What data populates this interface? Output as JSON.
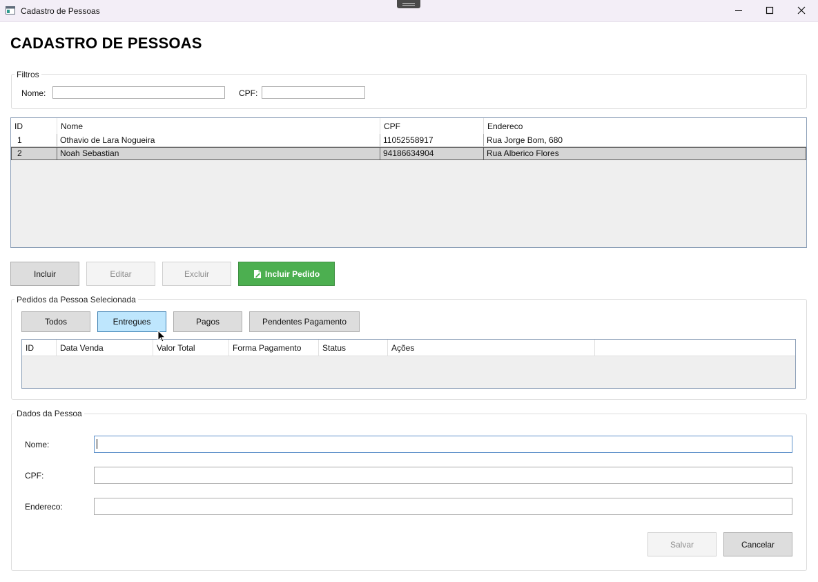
{
  "window": {
    "title": "Cadastro de Pessoas"
  },
  "page_title": "CADASTRO DE PESSOAS",
  "filters": {
    "legend": "Filtros",
    "nome_label": "Nome:",
    "nome_value": "",
    "cpf_label": "CPF:",
    "cpf_value": ""
  },
  "people_grid": {
    "columns": [
      "ID",
      "Nome",
      "CPF",
      "Endereco"
    ],
    "rows": [
      {
        "id": "1",
        "nome": "Othavio de Lara Nogueira",
        "cpf": "11052558917",
        "endereco": "Rua Jorge Bom, 680",
        "selected": false
      },
      {
        "id": "2",
        "nome": "Noah Sebastian",
        "cpf": "94186634904",
        "endereco": "Rua Alberico Flores",
        "selected": true
      }
    ]
  },
  "actions": {
    "incluir": "Incluir",
    "editar": "Editar",
    "excluir": "Excluir",
    "incluir_pedido": "Incluir Pedido"
  },
  "orders": {
    "legend": "Pedidos da Pessoa Selecionada",
    "filter_buttons": [
      "Todos",
      "Entregues",
      "Pagos",
      "Pendentes Pagamento"
    ],
    "hovered_filter": "Entregues",
    "columns": [
      "ID",
      "Data Venda",
      "Valor Total",
      "Forma Pagamento",
      "Status",
      "Ações"
    ]
  },
  "person_form": {
    "legend": "Dados da Pessoa",
    "nome_label": "Nome:",
    "cpf_label": "CPF:",
    "endereco_label": "Endereco:",
    "nome_value": "",
    "cpf_value": "",
    "endereco_value": "",
    "salvar": "Salvar",
    "cancelar": "Cancelar"
  },
  "colors": {
    "accent_green": "#4caf50",
    "hover_blue": "#bee6fd",
    "selection_gray": "#d5d5d5"
  },
  "icons": {
    "app": "app-window-icon",
    "minimize": "minimize-icon",
    "maximize": "maximize-icon",
    "close": "close-icon",
    "incluir_pedido": "document-edit-icon",
    "cursor": "mouse-pointer-icon"
  }
}
